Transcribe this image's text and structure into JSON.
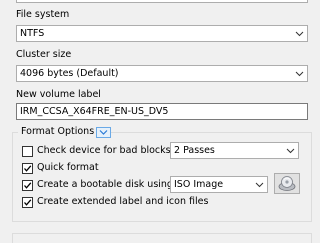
{
  "file_system": {
    "label": "File system",
    "value": "NTFS"
  },
  "cluster_size": {
    "label": "Cluster size",
    "value": "4096 bytes (Default)"
  },
  "volume_label": {
    "label": "New volume label",
    "value": "IRM_CCSA_X64FRE_EN-US_DV5"
  },
  "format_options": {
    "title": "Format Options",
    "check_bad_blocks": {
      "label": "Check device for bad blocks",
      "checked": false,
      "passes": "2 Passes"
    },
    "quick_format": {
      "label": "Quick format",
      "checked": true
    },
    "bootable": {
      "label": "Create a bootable disk using",
      "checked": true,
      "source": "ISO Image"
    },
    "extended_label": {
      "label": "Create extended label and icon files",
      "checked": true
    }
  },
  "icons": {
    "expand": "chevron-down-icon",
    "select_image": "disc-drive-icon",
    "dropdown": "dropdown-arrow-icon"
  },
  "colors": {
    "accent": "#4a90e2",
    "background": "#f0f0f0"
  }
}
